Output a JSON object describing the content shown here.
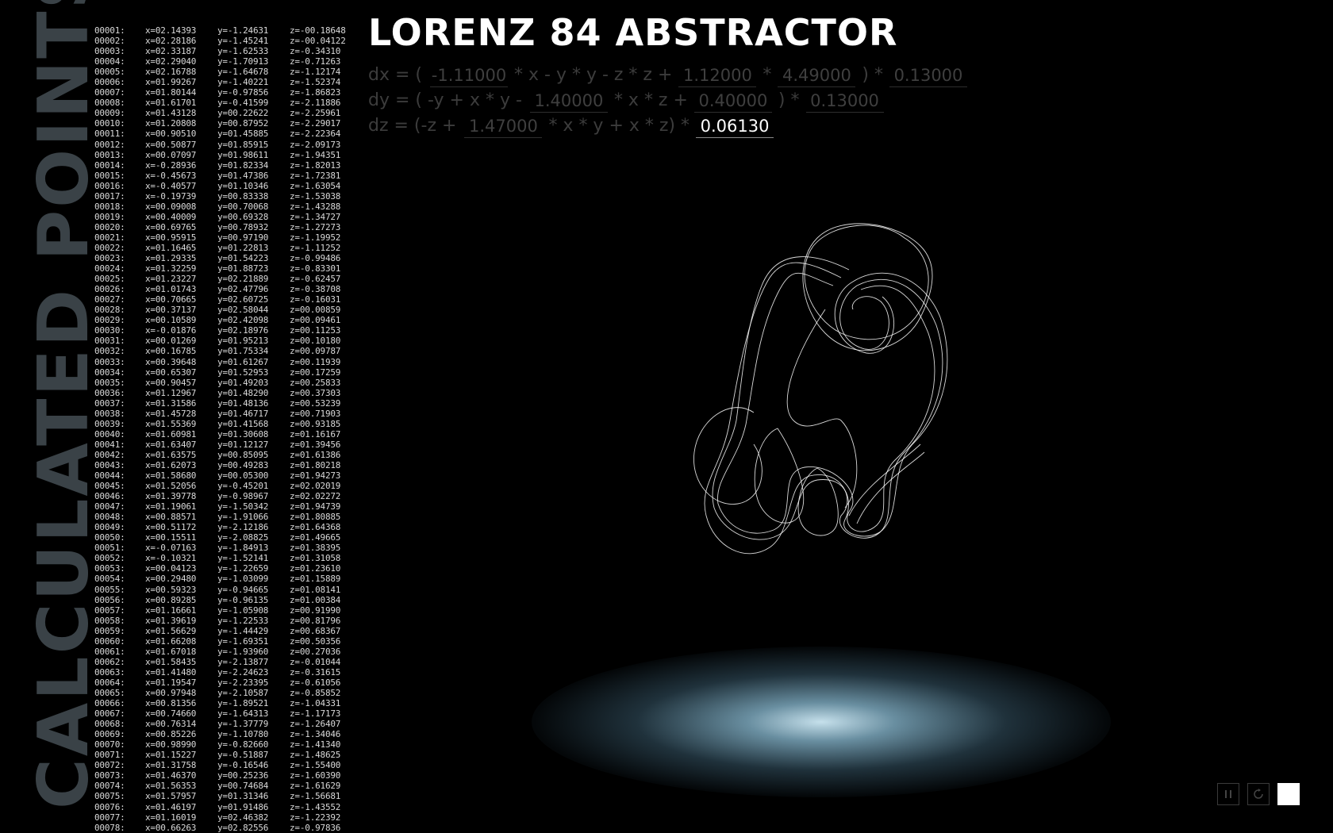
{
  "app": {
    "title": "LORENZ 84 ABSTRACTOR",
    "side_title": "CALCULATED POINTS"
  },
  "equations": {
    "dx": {
      "label": "dx = (",
      "p1": "-1.11000",
      "t1": "* x - y * y - z * z +",
      "p2": "1.12000",
      "t2": "*",
      "p3": "4.49000",
      "t3": ") *",
      "p4": "0.13000"
    },
    "dy": {
      "label": "dy = ( -y + x * y -",
      "p1": "1.40000",
      "t1": "* x * z +",
      "p2": "0.40000",
      "t2": ") *",
      "p3": "0.13000"
    },
    "dz": {
      "label": "dz = (-z +",
      "p1": "1.47000",
      "t1": "* x * y + x * z) *",
      "p2": "0.06130"
    }
  },
  "points": [
    [
      "00001:",
      "x=02.14393",
      "y=-1.24631",
      "z=-00.18648"
    ],
    [
      "00002:",
      "x=02.28186",
      "y=-1.45241",
      "z=-00.04122"
    ],
    [
      "00003:",
      "x=02.33187",
      "y=-1.62533",
      "z=-0.34310"
    ],
    [
      "00004:",
      "x=02.29040",
      "y=-1.70913",
      "z=-0.71263"
    ],
    [
      "00005:",
      "x=02.16788",
      "y=-1.64678",
      "z=-1.12174"
    ],
    [
      "00006:",
      "x=01.99267",
      "y=-1.40221",
      "z=-1.52374"
    ],
    [
      "00007:",
      "x=01.80144",
      "y=-0.97856",
      "z=-1.86823"
    ],
    [
      "00008:",
      "x=01.61701",
      "y=-0.41599",
      "z=-2.11886"
    ],
    [
      "00009:",
      "x=01.43128",
      "y=00.22622",
      "z=-2.25961"
    ],
    [
      "00010:",
      "x=01.20808",
      "y=00.87952",
      "z=-2.29017"
    ],
    [
      "00011:",
      "x=00.90510",
      "y=01.45885",
      "z=-2.22364"
    ],
    [
      "00012:",
      "x=00.50877",
      "y=01.85915",
      "z=-2.09173"
    ],
    [
      "00013:",
      "x=00.07097",
      "y=01.98611",
      "z=-1.94351"
    ],
    [
      "00014:",
      "x=-0.28936",
      "y=01.82334",
      "z=-1.82013"
    ],
    [
      "00015:",
      "x=-0.45673",
      "y=01.47386",
      "z=-1.72381"
    ],
    [
      "00016:",
      "x=-0.40577",
      "y=01.10346",
      "z=-1.63054"
    ],
    [
      "00017:",
      "x=-0.19739",
      "y=00.83338",
      "z=-1.53038"
    ],
    [
      "00018:",
      "x=00.09008",
      "y=00.70068",
      "z=-1.43288"
    ],
    [
      "00019:",
      "x=00.40009",
      "y=00.69328",
      "z=-1.34727"
    ],
    [
      "00020:",
      "x=00.69765",
      "y=00.78932",
      "z=-1.27273"
    ],
    [
      "00021:",
      "x=00.95915",
      "y=00.97190",
      "z=-1.19952"
    ],
    [
      "00022:",
      "x=01.16465",
      "y=01.22813",
      "z=-1.11252"
    ],
    [
      "00023:",
      "x=01.29335",
      "y=01.54223",
      "z=-0.99486"
    ],
    [
      "00024:",
      "x=01.32259",
      "y=01.88723",
      "z=-0.83301"
    ],
    [
      "00025:",
      "x=01.23227",
      "y=02.21889",
      "z=-0.62457"
    ],
    [
      "00026:",
      "x=01.01743",
      "y=02.47796",
      "z=-0.38708"
    ],
    [
      "00027:",
      "x=00.70665",
      "y=02.60725",
      "z=-0.16031"
    ],
    [
      "00028:",
      "x=00.37137",
      "y=02.58044",
      "z=00.00859"
    ],
    [
      "00029:",
      "x=00.10589",
      "y=02.42098",
      "z=00.09461"
    ],
    [
      "00030:",
      "x=-0.01876",
      "y=02.18976",
      "z=00.11253"
    ],
    [
      "00031:",
      "x=00.01269",
      "y=01.95213",
      "z=00.10180"
    ],
    [
      "00032:",
      "x=00.16785",
      "y=01.75334",
      "z=00.09787"
    ],
    [
      "00033:",
      "x=00.39648",
      "y=01.61267",
      "z=00.11939"
    ],
    [
      "00034:",
      "x=00.65307",
      "y=01.52953",
      "z=00.17259"
    ],
    [
      "00035:",
      "x=00.90457",
      "y=01.49203",
      "z=00.25833"
    ],
    [
      "00036:",
      "x=01.12967",
      "y=01.48290",
      "z=00.37303"
    ],
    [
      "00037:",
      "x=01.31586",
      "y=01.48136",
      "z=00.53239"
    ],
    [
      "00038:",
      "x=01.45728",
      "y=01.46717",
      "z=00.71903"
    ],
    [
      "00039:",
      "x=01.55369",
      "y=01.41568",
      "z=00.93185"
    ],
    [
      "00040:",
      "x=01.60981",
      "y=01.30608",
      "z=01.16167"
    ],
    [
      "00041:",
      "x=01.63407",
      "y=01.12127",
      "z=01.39456"
    ],
    [
      "00042:",
      "x=01.63575",
      "y=00.85095",
      "z=01.61386"
    ],
    [
      "00043:",
      "x=01.62073",
      "y=00.49283",
      "z=01.80218"
    ],
    [
      "00044:",
      "x=01.58680",
      "y=00.05300",
      "z=01.94273"
    ],
    [
      "00045:",
      "x=01.52056",
      "y=-0.45201",
      "z=02.02019"
    ],
    [
      "00046:",
      "x=01.39778",
      "y=-0.98967",
      "z=02.02272"
    ],
    [
      "00047:",
      "x=01.19061",
      "y=-1.50342",
      "z=01.94739"
    ],
    [
      "00048:",
      "x=00.88571",
      "y=-1.91066",
      "z=01.80885"
    ],
    [
      "00049:",
      "x=00.51172",
      "y=-2.12186",
      "z=01.64368"
    ],
    [
      "00050:",
      "x=00.15511",
      "y=-2.08825",
      "z=01.49665"
    ],
    [
      "00051:",
      "x=-0.07163",
      "y=-1.84913",
      "z=01.38395"
    ],
    [
      "00052:",
      "x=-0.10321",
      "y=-1.52141",
      "z=01.31058"
    ],
    [
      "00053:",
      "x=00.04123",
      "y=-1.22659",
      "z=01.23610"
    ],
    [
      "00054:",
      "x=00.29480",
      "y=-1.03099",
      "z=01.15889"
    ],
    [
      "00055:",
      "x=00.59323",
      "y=-0.94665",
      "z=01.08141"
    ],
    [
      "00056:",
      "x=00.89285",
      "y=-0.96135",
      "z=01.00384"
    ],
    [
      "00057:",
      "x=01.16661",
      "y=-1.05908",
      "z=00.91990"
    ],
    [
      "00058:",
      "x=01.39619",
      "y=-1.22533",
      "z=00.81796"
    ],
    [
      "00059:",
      "x=01.56629",
      "y=-1.44429",
      "z=00.68367"
    ],
    [
      "00060:",
      "x=01.66208",
      "y=-1.69351",
      "z=00.50356"
    ],
    [
      "00061:",
      "x=01.67018",
      "y=-1.93960",
      "z=00.27036"
    ],
    [
      "00062:",
      "x=01.58435",
      "y=-2.13877",
      "z=-0.01044"
    ],
    [
      "00063:",
      "x=01.41480",
      "y=-2.24623",
      "z=-0.31615"
    ],
    [
      "00064:",
      "x=01.19547",
      "y=-2.23395",
      "z=-0.61056"
    ],
    [
      "00065:",
      "x=00.97948",
      "y=-2.10587",
      "z=-0.85852"
    ],
    [
      "00066:",
      "x=00.81356",
      "y=-1.89521",
      "z=-1.04331"
    ],
    [
      "00067:",
      "x=00.74660",
      "y=-1.64313",
      "z=-1.17173"
    ],
    [
      "00068:",
      "x=00.76314",
      "y=-1.37779",
      "z=-1.26407"
    ],
    [
      "00069:",
      "x=00.85226",
      "y=-1.10780",
      "z=-1.34046"
    ],
    [
      "00070:",
      "x=00.98990",
      "y=-0.82660",
      "z=-1.41340"
    ],
    [
      "00071:",
      "x=01.15227",
      "y=-0.51887",
      "z=-1.48625"
    ],
    [
      "00072:",
      "x=01.31758",
      "y=-0.16546",
      "z=-1.55400"
    ],
    [
      "00073:",
      "x=01.46370",
      "y=00.25236",
      "z=-1.60390"
    ],
    [
      "00074:",
      "x=01.56353",
      "y=00.74684",
      "z=-1.61629"
    ],
    [
      "00075:",
      "x=01.57957",
      "y=01.31346",
      "z=-1.56681"
    ],
    [
      "00076:",
      "x=01.46197",
      "y=01.91486",
      "z=-1.43552"
    ],
    [
      "00077:",
      "x=01.16019",
      "y=02.46382",
      "z=-1.22392"
    ],
    [
      "00078:",
      "x=00.66263",
      "y=02.82556",
      "z=-0.97836"
    ]
  ],
  "controls": {
    "pause_icon": "pause-icon",
    "reset_icon": "reset-icon",
    "color_swatch": "#ffffff"
  }
}
